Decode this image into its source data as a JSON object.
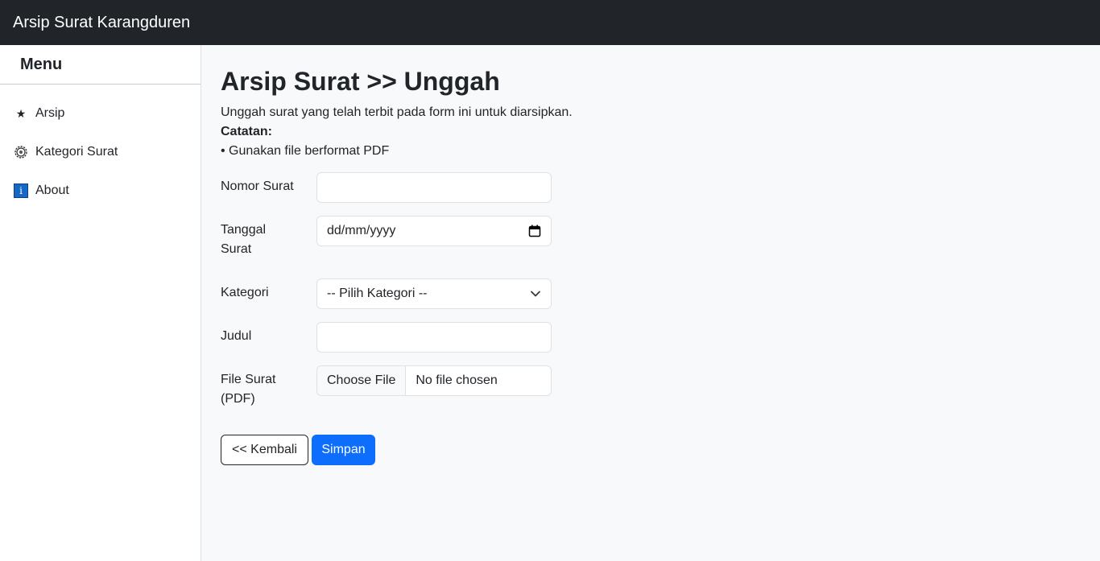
{
  "navbar": {
    "brand": "Arsip Surat Karangduren"
  },
  "sidebar": {
    "heading": "Menu",
    "items": [
      {
        "label": "Arsip",
        "icon": "star-icon"
      },
      {
        "label": "Kategori Surat",
        "icon": "gear-icon"
      },
      {
        "label": "About",
        "icon": "info-icon"
      }
    ]
  },
  "main": {
    "title": "Arsip Surat >> Unggah",
    "description": "Unggah surat yang telah terbit pada form ini untuk diarsipkan.",
    "note_label": "Catatan:",
    "note_item": "• Gunakan file berformat PDF",
    "form": {
      "nomor": {
        "label": "Nomor Surat",
        "value": ""
      },
      "tanggal": {
        "label_line1": "Tanggal",
        "label_line2": "Surat",
        "placeholder": "dd/mm/yyyy"
      },
      "kategori": {
        "label": "Kategori",
        "selected": "-- Pilih Kategori --"
      },
      "judul": {
        "label": "Judul",
        "value": ""
      },
      "file": {
        "label_line1": "File Surat",
        "label_line2": "(PDF)",
        "button": "Choose File",
        "status": "No file chosen"
      }
    },
    "buttons": {
      "back": "<< Kembali",
      "save": "Simpan"
    }
  },
  "colors": {
    "navbar_bg": "#212529",
    "primary": "#0d6efd",
    "page_bg": "#f8f9fa"
  }
}
